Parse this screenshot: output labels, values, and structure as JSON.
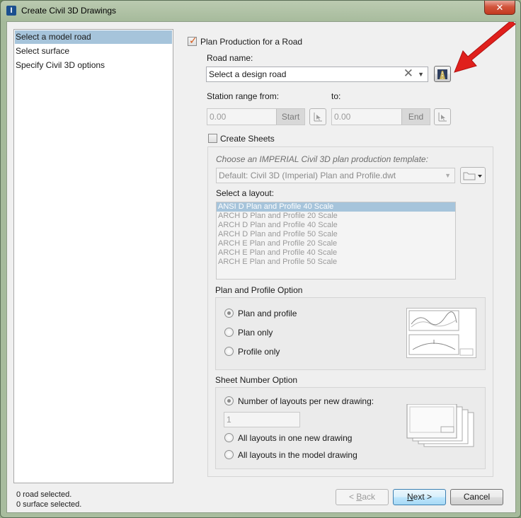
{
  "window": {
    "title": "Create Civil 3D Drawings",
    "close_glyph": "✕",
    "icon_glyph": "I"
  },
  "steps": [
    {
      "label": "Select a model road",
      "selected": true
    },
    {
      "label": "Select surface",
      "selected": false
    },
    {
      "label": "Specify Civil 3D options",
      "selected": false
    }
  ],
  "status": {
    "roads": "0 road selected.",
    "surfaces": "0 surface selected."
  },
  "plan_production": {
    "label": "Plan Production for a Road",
    "checked": true
  },
  "road": {
    "label": "Road name:",
    "value": "Select a design road"
  },
  "station": {
    "from_label": "Station range from:",
    "to_label": "to:",
    "from_value": "0.00",
    "to_value": "0.00",
    "start_label": "Start",
    "end_label": "End"
  },
  "create_sheets": {
    "label": "Create Sheets",
    "checked": false
  },
  "template": {
    "label": "Choose an IMPERIAL Civil 3D plan production template:",
    "value": "Default: Civil 3D (Imperial) Plan and Profile.dwt"
  },
  "layout": {
    "label": "Select a layout:",
    "items": [
      "ANSI D Plan and Profile 40 Scale",
      "ARCH D Plan and Profile 20 Scale",
      "ARCH D Plan and Profile 40 Scale",
      "ARCH D Plan and Profile 50 Scale",
      "ARCH E Plan and Profile 20 Scale",
      "ARCH E Plan and Profile 40 Scale",
      "ARCH E Plan and Profile 50 Scale"
    ]
  },
  "plan_profile_option": {
    "title": "Plan and Profile Option",
    "options": [
      "Plan and profile",
      "Plan only",
      "Profile only"
    ]
  },
  "sheet_number_option": {
    "title": "Sheet Number Option",
    "layouts_per_drawing_label": "Number of layouts per new drawing:",
    "layouts_per_drawing_value": "1",
    "one_drawing_label": "All layouts in one new drawing",
    "model_drawing_label": "All layouts in the model drawing"
  },
  "buttons": {
    "back_prefix": "< ",
    "back_key": "B",
    "back_rest": "ack",
    "next_key": "N",
    "next_rest": "ext >",
    "cancel": "Cancel"
  },
  "colors": {
    "selection": "#a6c4db",
    "checkmark": "#d55a1a",
    "arrow": "#e0201c"
  },
  "icons": [
    "road-select-icon",
    "pick-point-icon",
    "folder-icon",
    "dropdown-arrow-icon",
    "clear-icon",
    "red-arrow-annotation"
  ]
}
